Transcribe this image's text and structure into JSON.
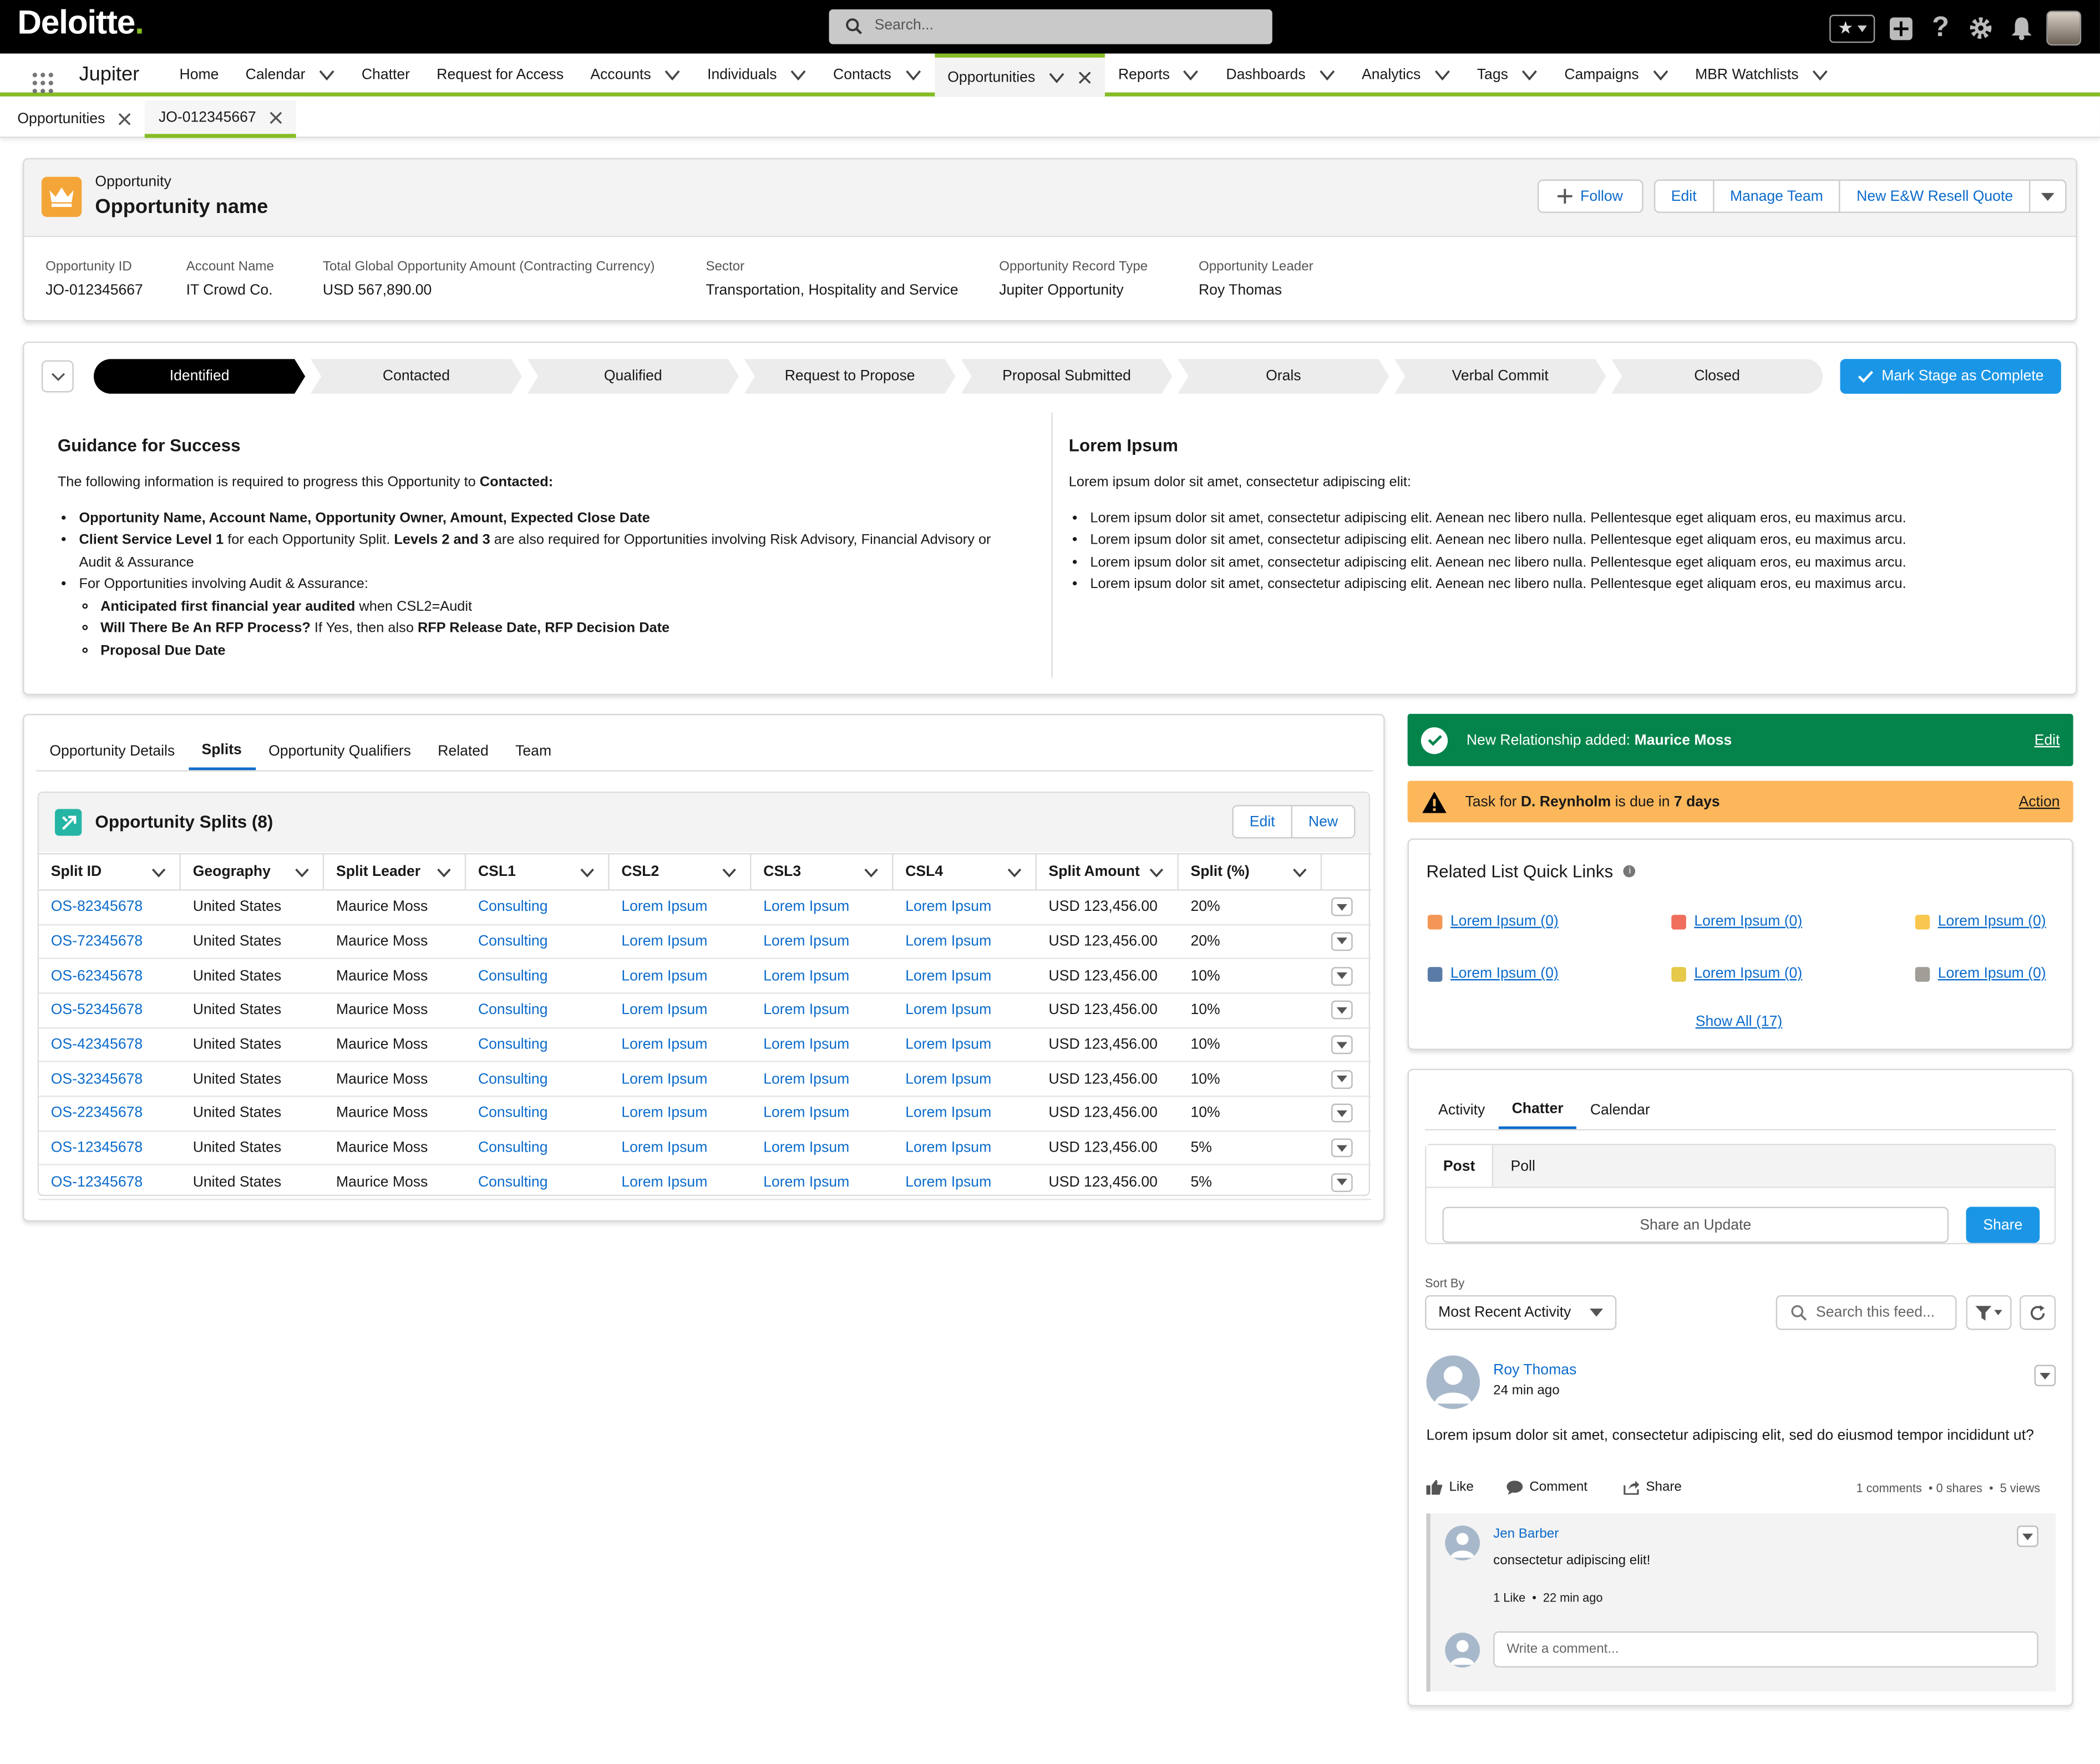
{
  "brand": {
    "logo": "Deloitte",
    "logo_dot": ".",
    "app_name": "Jupiter"
  },
  "search": {
    "placeholder": "Search..."
  },
  "nav": {
    "items": [
      {
        "label": "Home",
        "chevron": false
      },
      {
        "label": "Calendar",
        "chevron": true
      },
      {
        "label": "Chatter",
        "chevron": false
      },
      {
        "label": "Request for Access",
        "chevron": false
      },
      {
        "label": "Accounts",
        "chevron": true
      },
      {
        "label": "Individuals",
        "chevron": true
      },
      {
        "label": "Contacts",
        "chevron": true
      },
      {
        "label": "Opportunities",
        "chevron": true,
        "active": true
      },
      {
        "label": "Reports",
        "chevron": true
      },
      {
        "label": "Dashboards",
        "chevron": true
      },
      {
        "label": "Analytics",
        "chevron": true
      },
      {
        "label": "Tags",
        "chevron": true
      },
      {
        "label": "Campaigns",
        "chevron": true
      },
      {
        "label": "MBR Watchlists",
        "chevron": true
      }
    ]
  },
  "workspace_tabs": [
    {
      "label": "Opportunities"
    },
    {
      "label": "JO-012345667"
    }
  ],
  "header": {
    "object_label": "Opportunity",
    "title": "Opportunity name",
    "buttons": {
      "follow": "Follow",
      "edit": "Edit",
      "manage_team": "Manage Team",
      "resell_quote": "New E&W Resell Quote"
    },
    "fields": [
      {
        "label": "Opportunity ID",
        "value": "JO-012345667"
      },
      {
        "label": "Account Name",
        "value": "IT Crowd Co."
      },
      {
        "label": "Total Global Opportunity Amount (Contracting Currency)",
        "value": "USD 567,890.00"
      },
      {
        "label": "Sector",
        "value": "Transportation, Hospitality and Service"
      },
      {
        "label": "Opportunity Record Type",
        "value": "Jupiter Opportunity"
      },
      {
        "label": "Opportunity Leader",
        "value": "Roy Thomas"
      }
    ]
  },
  "path": {
    "stages": [
      "Identified",
      "Contacted",
      "Qualified",
      "Request to Propose",
      "Proposal Submitted",
      "Orals",
      "Verbal Commit",
      "Closed"
    ],
    "current": "Identified",
    "mark_complete": "Mark Stage as Complete"
  },
  "guidance": {
    "title": "Guidance for Success",
    "intro": "The following information is required to progress this Opportunity to",
    "intro_bold": "Contacted:",
    "b1": "Opportunity Name, Account Name, Opportunity Owner, Amount, Expected Close Date",
    "b2_bold": "Client Service Level 1",
    "b2_mid": " for each Opportunity Split. ",
    "b2_bold2": "Levels 2 and 3",
    "b2_end": " are also required for Opportunities involving Risk Advisory, Financial Advisory or Audit & Assurance",
    "b3": "For Opportunities involving Audit & Assurance:",
    "s1_bold": "Anticipated first financial year audited",
    "s1_end": " when CSL2=Audit",
    "s2_bold": "Will There Be An RFP Process?",
    "s2_mid": " If Yes, then also ",
    "s2_bold2": "RFP Release Date, RFP Decision Date",
    "s3_bold": "Proposal Due Date"
  },
  "lorem": {
    "title": "Lorem Ipsum",
    "intro": "Lorem ipsum dolor sit amet, consectetur adipiscing elit:",
    "bullets": [
      "Lorem ipsum dolor sit amet, consectetur adipiscing elit. Aenean nec libero nulla. Pellentesque eget aliquam eros, eu maximus arcu.",
      "Lorem ipsum dolor sit amet, consectetur adipiscing elit. Aenean nec libero nulla. Pellentesque eget aliquam eros, eu maximus arcu.",
      "Lorem ipsum dolor sit amet, consectetur adipiscing elit. Aenean nec libero nulla. Pellentesque eget aliquam eros, eu maximus arcu.",
      "Lorem ipsum dolor sit amet, consectetur adipiscing elit. Aenean nec libero nulla. Pellentesque eget aliquam eros, eu maximus arcu."
    ]
  },
  "detail_tabs": {
    "items": [
      "Opportunity Details",
      "Splits",
      "Opportunity Qualifiers",
      "Related",
      "Team"
    ],
    "active": "Splits"
  },
  "splits": {
    "title": "Opportunity Splits (8)",
    "edit": "Edit",
    "new": "New",
    "columns": [
      "Split ID",
      "Geography",
      "Split Leader",
      "CSL1",
      "CSL2",
      "CSL3",
      "CSL4",
      "Split Amount",
      "Split (%)"
    ],
    "rows": [
      [
        "OS-82345678",
        "United States",
        "Maurice Moss",
        "Consulting",
        "Lorem Ipsum",
        "Lorem Ipsum",
        "Lorem Ipsum",
        "USD 123,456.00",
        "20%"
      ],
      [
        "OS-72345678",
        "United States",
        "Maurice Moss",
        "Consulting",
        "Lorem Ipsum",
        "Lorem Ipsum",
        "Lorem Ipsum",
        "USD 123,456.00",
        "20%"
      ],
      [
        "OS-62345678",
        "United States",
        "Maurice Moss",
        "Consulting",
        "Lorem Ipsum",
        "Lorem Ipsum",
        "Lorem Ipsum",
        "USD 123,456.00",
        "10%"
      ],
      [
        "OS-52345678",
        "United States",
        "Maurice Moss",
        "Consulting",
        "Lorem Ipsum",
        "Lorem Ipsum",
        "Lorem Ipsum",
        "USD 123,456.00",
        "10%"
      ],
      [
        "OS-42345678",
        "United States",
        "Maurice Moss",
        "Consulting",
        "Lorem Ipsum",
        "Lorem Ipsum",
        "Lorem Ipsum",
        "USD 123,456.00",
        "10%"
      ],
      [
        "OS-32345678",
        "United States",
        "Maurice Moss",
        "Consulting",
        "Lorem Ipsum",
        "Lorem Ipsum",
        "Lorem Ipsum",
        "USD 123,456.00",
        "10%"
      ],
      [
        "OS-22345678",
        "United States",
        "Maurice Moss",
        "Consulting",
        "Lorem Ipsum",
        "Lorem Ipsum",
        "Lorem Ipsum",
        "USD 123,456.00",
        "10%"
      ],
      [
        "OS-12345678",
        "United States",
        "Maurice Moss",
        "Consulting",
        "Lorem Ipsum",
        "Lorem Ipsum",
        "Lorem Ipsum",
        "USD 123,456.00",
        "5%"
      ],
      [
        "OS-12345678",
        "United States",
        "Maurice Moss",
        "Consulting",
        "Lorem Ipsum",
        "Lorem Ipsum",
        "Lorem Ipsum",
        "USD 123,456.00",
        "5%"
      ]
    ]
  },
  "toast_success": {
    "text": "New Relationship added:",
    "name": "Maurice Moss",
    "action": "Edit"
  },
  "toast_warning": {
    "pre": "Task for",
    "name": "D. Reynholm",
    "mid": "is due in",
    "days": "7 days",
    "action": "Action"
  },
  "quick_links": {
    "title": "Related List Quick Links",
    "items": [
      {
        "label": "Lorem Ipsum (0)",
        "color": "#f49756"
      },
      {
        "label": "Lorem Ipsum (0)",
        "color": "#ef6e5c"
      },
      {
        "label": "Lorem Ipsum (0)",
        "color": "#f9c74f"
      },
      {
        "label": "Lorem Ipsum (0)",
        "color": "#5a7ba6"
      },
      {
        "label": "Lorem Ipsum (0)",
        "color": "#e6c84a"
      },
      {
        "label": "Lorem Ipsum (0)",
        "color": "#a09e97"
      }
    ],
    "show_all": "Show All (17)"
  },
  "activity_tabs": {
    "items": [
      "Activity",
      "Chatter",
      "Calendar"
    ],
    "active": "Chatter"
  },
  "publisher": {
    "tabs": [
      "Post",
      "Poll"
    ],
    "placeholder": "Share an Update",
    "share": "Share"
  },
  "feed": {
    "sort_label": "Sort By",
    "sort_value": "Most Recent Activity",
    "search_placeholder": "Search this feed...",
    "post": {
      "author": "Roy Thomas",
      "time": "24 min ago",
      "body": "Lorem ipsum dolor sit amet, consectetur adipiscing elit, sed do eiusmod tempor incididunt ut?",
      "like": "Like",
      "comment": "Comment",
      "share": "Share",
      "stats": "1 comments  • 0 shares  •  5 views"
    },
    "comment": {
      "author": "Jen Barber",
      "body": "consectetur adipiscing elit!",
      "meta": "1 Like  •  22 min ago"
    },
    "write_placeholder": "Write a comment..."
  }
}
